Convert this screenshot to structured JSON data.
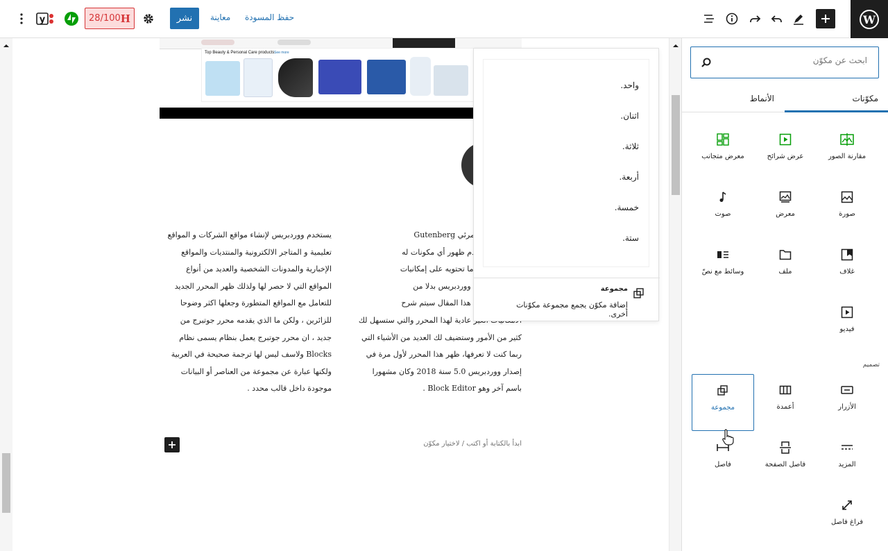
{
  "toolbar": {
    "publish_label": "نشر",
    "preview_label": "معاينة",
    "save_draft_label": "حفظ المسودة",
    "seo_score": "28/100",
    "seo_letter": "H"
  },
  "inserter": {
    "search_placeholder": "ابحث عن مكوّن",
    "tabs": [
      {
        "label": "مكوّنات",
        "active": true
      },
      {
        "label": "الأنماط",
        "active": false
      }
    ],
    "media_blocks": [
      {
        "label": "مقارنة الصور",
        "icon": "image-compare-icon"
      },
      {
        "label": "عرض شرائح",
        "icon": "slideshow-icon"
      },
      {
        "label": "معرض متجانب",
        "icon": "tiled-gallery-icon"
      },
      {
        "label": "صورة",
        "icon": "image-icon"
      },
      {
        "label": "معرض",
        "icon": "gallery-icon"
      },
      {
        "label": "صوت",
        "icon": "audio-icon"
      },
      {
        "label": "غلاف",
        "icon": "cover-icon"
      },
      {
        "label": "ملف",
        "icon": "file-icon"
      },
      {
        "label": "وسائط مع نصّ",
        "icon": "media-text-icon"
      },
      {
        "label": "فيديو",
        "icon": "video-icon"
      }
    ],
    "design_heading": "تصميم",
    "design_blocks": [
      {
        "label": "الأزرار",
        "icon": "buttons-icon"
      },
      {
        "label": "أعمدة",
        "icon": "columns-icon"
      },
      {
        "label": "مجموعة",
        "icon": "group-icon"
      },
      {
        "label": "المزيد",
        "icon": "more-icon"
      },
      {
        "label": "فاصل الصفحة",
        "icon": "page-break-icon"
      },
      {
        "label": "فاصل",
        "icon": "separator-icon"
      },
      {
        "label": "فراغ فاصل",
        "icon": "spacer-icon"
      }
    ]
  },
  "preview": {
    "lines": [
      "واحد.",
      "اثنان.",
      "ثلاثة.",
      "أربعة.",
      "خمسة.",
      "ستة."
    ],
    "block_title": "مجموعة",
    "block_description": "إضافة مكوّن يجمع مجموعة مكوّنات أخرى."
  },
  "canvas": {
    "banner_title": "Top Beauty & Personal Care products",
    "banner_link": "See more",
    "right_column_lines": [
      "د هذا المحرر المرئي Gutenberg",
      "اب بالدهشة لعدم ظهور أي مكونات له",
      "رؤيتك لقائمته وما تحتويه على إمكانيات",
      "الاستعانة به في ووردبريس بدلا من",
      "TinyMCE في هذا المقال سيتم شرح",
      "الامكانيات الغير عادية لهذا المحرر والتي ستسهل لك",
      "كثير من الأمور وستضيف لك العديد من الأشياء التي",
      "ربما كنت لا تعرفها، ظهر هذا المحرر لأول مرة في",
      "إصدار ووردبريس 5.0 سنة 2018 وكان مشهورا",
      "باسم آخر وهو Block Editor ."
    ],
    "left_column_lines": [
      "يستخدم ووردبريس لإنشاء مواقع الشركات و المواقع",
      "تعليمية و المتاجر الالكترونية والمنتديات والمواقع",
      "الإخبارية والمدونات الشخصية والعديد من أنواع",
      "المواقع التي لا حصر لها ولذلك ظهر المحرر الجديد",
      "للتعامل مع المواقع المتطورة وجعلها اكثر وضوحا",
      "للزائرين ، ولكن ما الذي يقدمه محرر جوتبرج من",
      "جديد ، ان محرر جوتبرج يعمل بنظام يسمى نظام",
      "Blocks ولاسف ليس لها ترجمة صحيحة في العربية",
      "ولكنها عبارة عن مجموعة من العناصر أو البيانات",
      "موجودة داخل قالب محدد ."
    ],
    "empty_block_placeholder": "ابدأ بالكتابة أو اكتب / لاختيار مكوّن"
  },
  "colors": {
    "accent": "#2271b1",
    "dark": "#1e1e1e",
    "seo_red": "#d63638",
    "jetpack_green": "#069e08"
  }
}
